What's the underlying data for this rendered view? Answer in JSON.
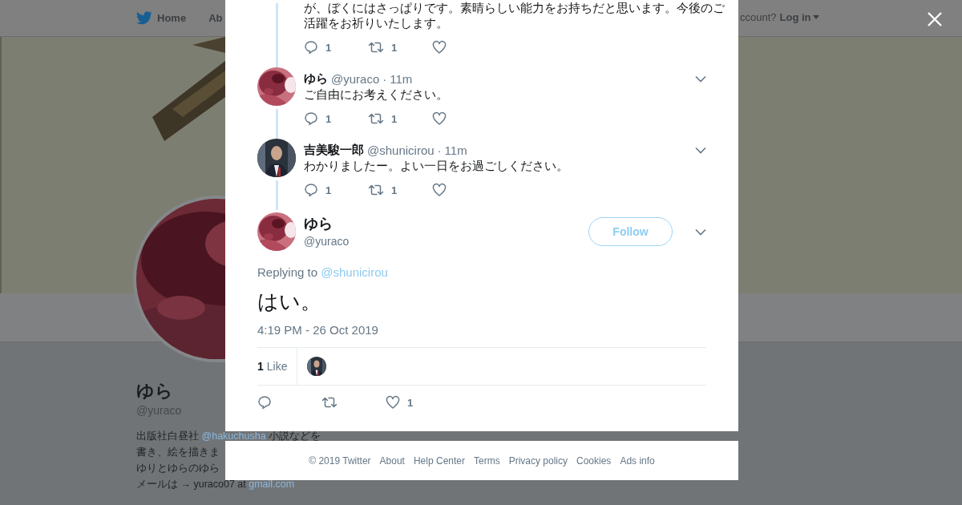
{
  "nav": {
    "items": [
      {
        "label": "Home",
        "kind": "home"
      },
      {
        "label": "Ab",
        "kind": "plain"
      }
    ],
    "account_prompt": "ccount?",
    "login": "Log in"
  },
  "profile": {
    "name": "ゆら",
    "handle": "@yuraco",
    "bio": [
      {
        "parts": [
          {
            "text": "出版社白昼社 ",
            "link": false
          },
          {
            "text": "@hakuchusha",
            "link": true
          },
          {
            "text": " 小説などを",
            "link": false
          }
        ]
      },
      {
        "parts": [
          {
            "text": "書き、絵を描きま",
            "link": false
          }
        ]
      },
      {
        "parts": [
          {
            "text": "ゆりとゆらのゆら",
            "link": false
          }
        ]
      },
      {
        "parts": [
          {
            "text": "メールは → yuraco07 at ",
            "link": false
          },
          {
            "text": "gmail.com",
            "link": true
          }
        ]
      }
    ]
  },
  "thread": [
    {
      "kind": "partial",
      "text_lines": [
        "が、ぼくにはさっぱりです。素晴らしい能力をお持ちだと思います。今後のご",
        "活躍をお祈りいたします。"
      ],
      "actions": [
        {
          "kind": "reply",
          "count": "1"
        },
        {
          "kind": "retweet",
          "count": "1"
        },
        {
          "kind": "like"
        }
      ]
    },
    {
      "kind": "full",
      "name": "ゆら",
      "handle": "@yuraco",
      "separator": "·",
      "time": "11m",
      "text": "ご自由にお考えください。",
      "actions": [
        {
          "kind": "reply",
          "count": "1"
        },
        {
          "kind": "retweet",
          "count": "1"
        },
        {
          "kind": "like"
        }
      ]
    },
    {
      "kind": "full",
      "name": "吉美駿一郎",
      "handle": "@shunicirou",
      "separator": "·",
      "time": "11m",
      "text": "わかりましたー。よい一日をお過ごしください。",
      "actions": [
        {
          "kind": "reply",
          "count": "1"
        },
        {
          "kind": "retweet",
          "count": "1"
        },
        {
          "kind": "like"
        }
      ]
    }
  ],
  "main_tweet": {
    "name": "ゆら",
    "handle": "@yuraco",
    "follow": "Follow",
    "replying_label": "Replying to",
    "replying_to": "@shunicirou",
    "text": "はい。",
    "timestamp": "4:19 PM - 26 Oct 2019",
    "likes_count": "1",
    "likes_label": "Like",
    "actions": [
      {
        "kind": "reply"
      },
      {
        "kind": "retweet"
      },
      {
        "kind": "like",
        "count": "1"
      }
    ]
  },
  "footer": {
    "links": [
      "© 2019 Twitter",
      "About",
      "Help Center",
      "Terms",
      "Privacy policy",
      "Cookies",
      "Ads info"
    ]
  }
}
